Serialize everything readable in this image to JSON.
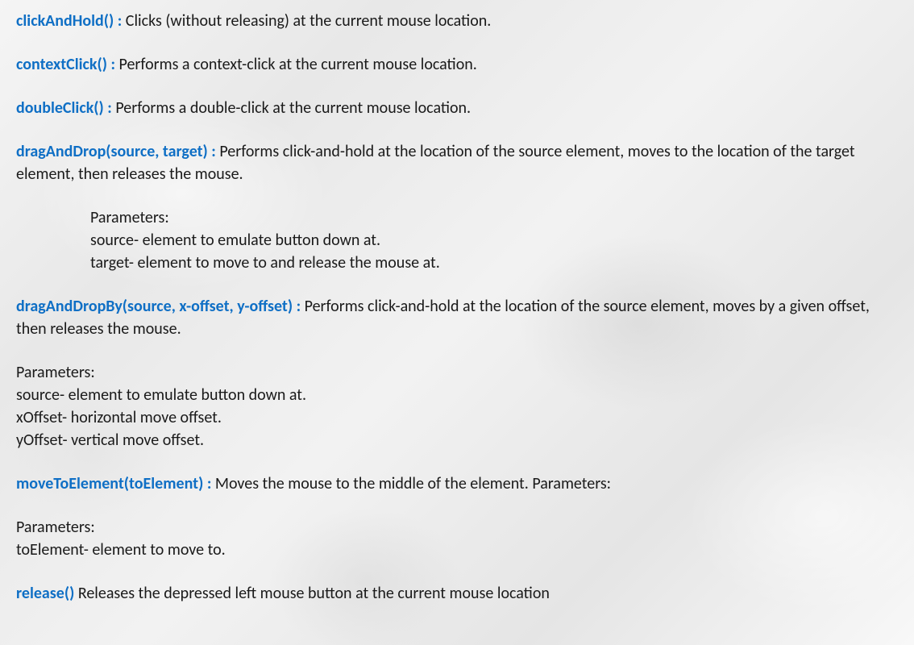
{
  "methods": {
    "clickAndHold": {
      "name": "clickAndHold() :",
      "desc": " Clicks (without releasing) at the current mouse location."
    },
    "contextClick": {
      "name": "contextClick() :",
      "desc": " Performs a context-click at the current mouse location."
    },
    "doubleClick": {
      "name": "doubleClick() :",
      "desc": " Performs a double-click at the current mouse location."
    },
    "dragAndDrop": {
      "name": "dragAndDrop(source, target) :",
      "desc": " Performs click-and-hold at the location of the source element, moves to the location of the target element, then releases the mouse.",
      "params": {
        "header": "Parameters:",
        "p1": "source- element to emulate button down at.",
        "p2": "target- element to move to and release the mouse at."
      }
    },
    "dragAndDropBy": {
      "name": "dragAndDropBy(source, x-offset, y-offset) :",
      "desc": " Performs click-and-hold at the location of the source element, moves by a given offset, then releases the mouse.",
      "params": {
        "header": "Parameters:",
        "p1": "source- element to emulate button down at.",
        "p2": "xOffset- horizontal move offset.",
        "p3": "yOffset- vertical move offset."
      }
    },
    "moveToElement": {
      "name": "moveToElement(toElement) :",
      "desc": "  Moves the mouse to the middle of the element. Parameters:",
      "params": {
        "header": "Parameters:",
        "p1": "toElement- element to move to."
      }
    },
    "release": {
      "name": "release()",
      "desc": "  Releases the depressed left mouse button at the current mouse location"
    }
  }
}
